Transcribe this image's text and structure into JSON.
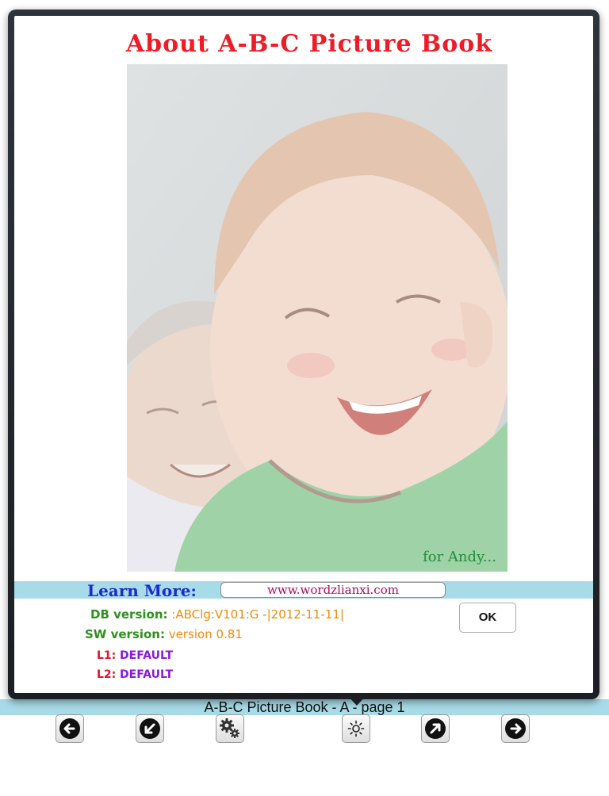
{
  "dialog": {
    "title": "About A-B-C Picture Book",
    "photo_caption": "for Andy...",
    "learn_more_label": "Learn More:",
    "website": "www.wordzlianxi.com",
    "db_version_label": "DB version:",
    "db_version_value": ":ABClg:V101:G -|2012-11-11|",
    "sw_version_label": "SW version:",
    "sw_version_value": "version 0.81",
    "l1_label": "L1:",
    "l1_value": "DEFAULT",
    "l2_label": "L2:",
    "l2_value": "DEFAULT",
    "ok_label": "OK"
  },
  "app": {
    "caption": "A-B-C Picture Book - A - page 1"
  },
  "toolbar": {
    "buttons": [
      {
        "icon": "arrow-left-icon"
      },
      {
        "icon": "arrow-down-left-icon"
      },
      {
        "icon": "gears-icon"
      },
      {
        "icon": "brightness-icon"
      },
      {
        "icon": "arrow-up-right-icon"
      },
      {
        "icon": "arrow-right-icon"
      }
    ]
  },
  "colors": {
    "title": "#ee1c24",
    "accent_strip": "#a8dbe8",
    "label_green": "#2f8f1f",
    "value_orange": "#f08a0a",
    "label_red": "#e2142a",
    "value_purple": "#8a1ae0",
    "link": "#b00a63"
  }
}
